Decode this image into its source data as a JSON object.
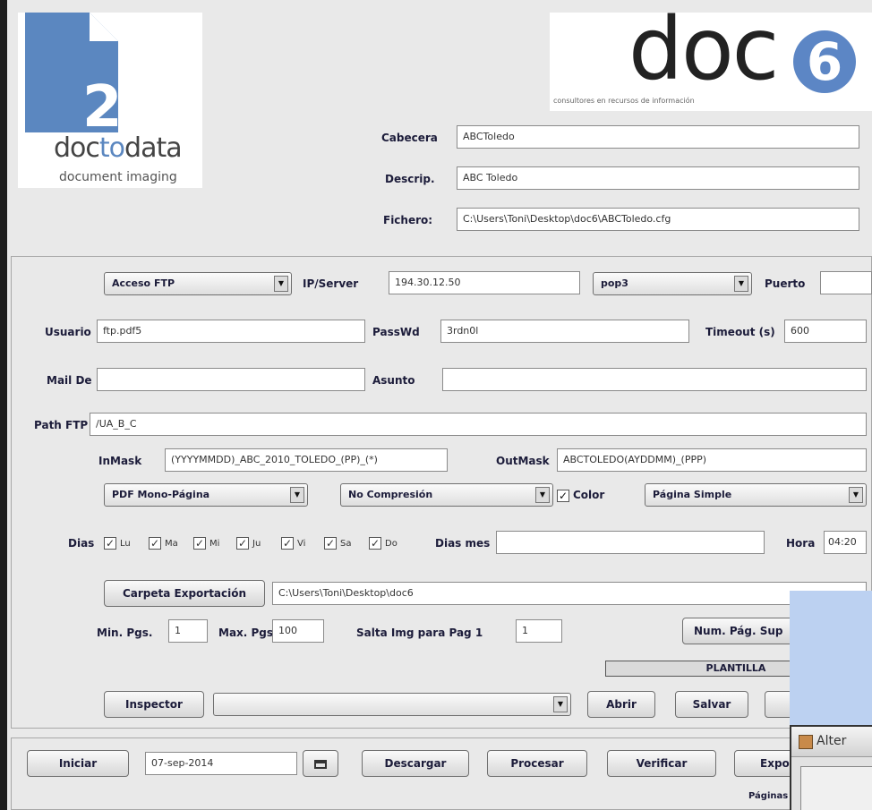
{
  "header": {
    "logo_left_digit": "2",
    "logo_left_brand": "doctodata",
    "logo_left_brand_parts": [
      "doc",
      "to",
      "data"
    ],
    "logo_left_sub": "document imaging",
    "logo_right_text": "doc",
    "logo_right_digit": "6",
    "logo_right_tagline": "consultores en recursos de información",
    "cabecera_label": "Cabecera",
    "cabecera_value": "ABCToledo",
    "descrip_label": "Descrip.",
    "descrip_value": "ABC Toledo",
    "fichero_label": "Fichero:",
    "fichero_value": "C:\\Users\\Toni\\Desktop\\doc6\\ABCToledo.cfg"
  },
  "connection": {
    "access_select": "Acceso FTP",
    "server_label": "IP/Server",
    "server_value": "194.30.12.50",
    "protocol_select": "pop3",
    "port_label": "Puerto",
    "port_value": "",
    "user_label": "Usuario",
    "user_value": "ftp.pdf5",
    "password_label": "PassWd",
    "password_value": "3rdn0l",
    "timeout_label": "Timeout (s)",
    "timeout_value": "600",
    "mail_label": "Mail De",
    "mail_value": "",
    "subject_label": "Asunto",
    "subject_value": "",
    "path_label": "Path FTP",
    "path_value": "/UA_B_C"
  },
  "masks": {
    "inmask_label": "InMask",
    "inmask_value": "(YYYYMMDD)_ABC_2010_TOLEDO_(PP)_(*)",
    "outmask_label": "OutMask",
    "outmask_value": "ABCTOLEDO(AYDDMM)_(PPP)"
  },
  "format": {
    "pdf_select": "PDF Mono-Página",
    "compression_select": "No Compresión",
    "color_label": "Color",
    "page_select": "Página Simple"
  },
  "schedule": {
    "days_label": "Dias",
    "days": [
      "Lu",
      "Ma",
      "Mi",
      "Ju",
      "Vi",
      "Sa",
      "Do"
    ],
    "days_month_label": "Dias mes",
    "days_month_value": "",
    "hour_label": "Hora",
    "hour_value": "04:20"
  },
  "export": {
    "folder_button": "Carpeta Exportación",
    "folder_value": "C:\\Users\\Toni\\Desktop\\doc6",
    "min_label": "Min. Pgs.",
    "min_value": "1",
    "max_label": "Max. Pgs.",
    "max_value": "100",
    "skip_label": "Salta Img para Pag 1",
    "skip_value": "1",
    "num_button": "Num. Pág. Sup",
    "plantilla_label": "PLANTILLA"
  },
  "inspector": {
    "button": "Inspector",
    "select_value": "",
    "open_button": "Abrir",
    "save_button": "Salvar"
  },
  "actions": {
    "start_button": "Iniciar",
    "date_value": "07-sep-2014",
    "download_button": "Descargar",
    "process_button": "Procesar",
    "verify_button": "Verificar",
    "export_button": "Expo",
    "pages_label": "Páginas"
  },
  "overlay": {
    "window_title": "Alter"
  },
  "colors": {
    "window_bg": "#e9e9e9",
    "logo_left_blue": "#5b87c0",
    "logo_right_circle": "#5c86c5",
    "overlay_blue": "#bcd1f1"
  }
}
